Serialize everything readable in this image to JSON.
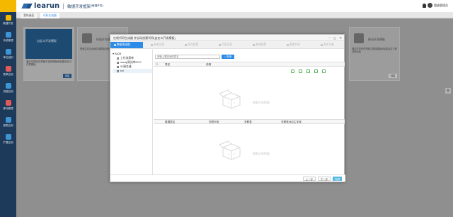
{
  "header": {
    "brand_name": "learun",
    "subtitle": "敏捷开发框架",
    "version": "[敏捷开发]",
    "user": "超级管理员"
  },
  "sidebar": {
    "items": [
      {
        "label": "敏捷开发",
        "color": "#f5b800"
      },
      {
        "label": "系统管理",
        "color": "#3d95d5"
      },
      {
        "label": "单位组织",
        "color": "#3d95d5"
      },
      {
        "label": "表单应用",
        "color": "#e05a5a"
      },
      {
        "label": "流程应用",
        "color": "#3d95d5"
      },
      {
        "label": "移动管理",
        "color": "#e05a5a"
      },
      {
        "label": "报表应用",
        "color": "#3d95d5"
      },
      {
        "label": "扩展应用",
        "color": "#3d95d5"
      }
    ]
  },
  "tabs": [
    {
      "label": "我的桌面"
    },
    {
      "label": "代码生成器"
    }
  ],
  "background_cards": [
    {
      "title": "自定义开发模板",
      "desc": "通过可视化在界面中选择模版和创建自定义开发模板",
      "btn": "创建"
    },
    {
      "title": "快速开发模板",
      "desc": "快速生成企业级应用模板页面",
      "btn": "创建"
    },
    {
      "title": "移动开发模板",
      "desc": "通过可视化在界面中选择模版和创建自定义移动端页面",
      "btn": "创建"
    }
  ],
  "modal": {
    "title": "在线代码生成器 并自动创建代码(自定义开发模板)",
    "steps": [
      {
        "label": "数据表选取"
      },
      {
        "label": "表单页面"
      },
      {
        "label": "条件配置"
      },
      {
        "label": "列表页面"
      },
      {
        "label": "查询配置"
      },
      {
        "label": "查看代码"
      },
      {
        "label": "发布功能"
      }
    ],
    "tree": [
      {
        "label": "BA28",
        "level": 0
      },
      {
        "label": "工作流表单",
        "level": 1
      },
      {
        "label": "mssql测试库2017",
        "level": 1
      },
      {
        "label": "51服务器",
        "level": 1
      },
      {
        "label": "exl",
        "level": 1
      }
    ],
    "search_placeholder": "请输入要查询的表名",
    "search_btn": "查询",
    "grid1_headers": [
      "表名",
      "说明"
    ],
    "grid2_headers": [
      "数据表名",
      "关联字段",
      "关联表",
      "关联表对应主字段"
    ],
    "empty_text": "抱歉没有数据",
    "footer": {
      "prev": "上一步",
      "next": "下一步",
      "finish": "完成"
    }
  }
}
